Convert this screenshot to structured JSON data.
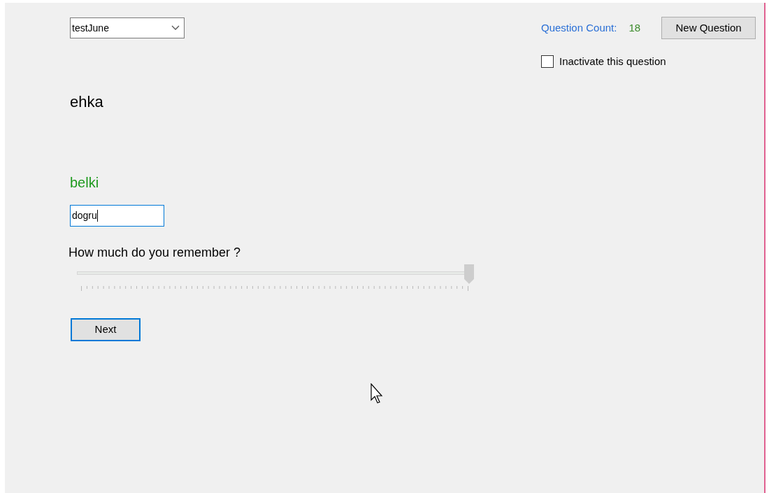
{
  "deck_select": {
    "value": "testJune"
  },
  "question_count": {
    "label": "Question Count:",
    "value": "18"
  },
  "new_question_button": "New Question",
  "inactivate": {
    "label": "Inactivate this question",
    "checked": false
  },
  "question": "ehka",
  "answer": "belki",
  "answer_field": {
    "value": "dogru"
  },
  "remember": {
    "label": "How much do you remember ?",
    "level": 1
  },
  "next_button": "Next"
}
